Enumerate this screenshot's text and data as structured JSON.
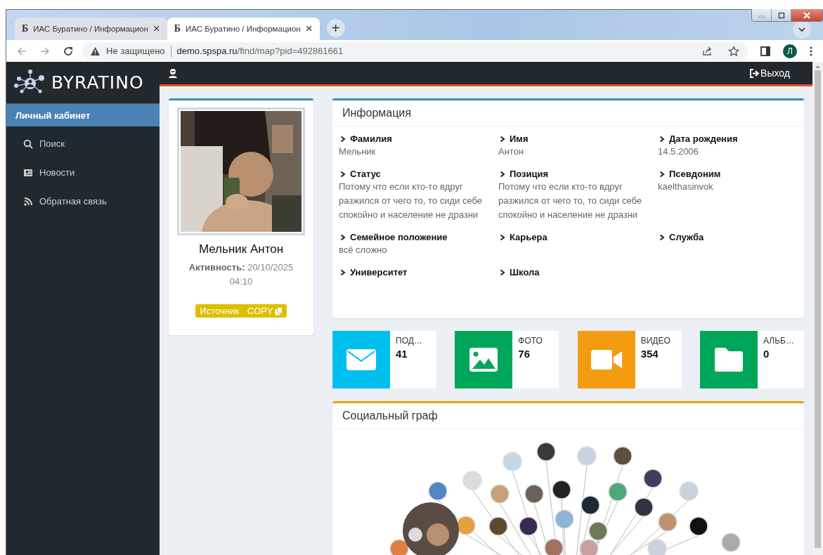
{
  "browser": {
    "tabs": [
      {
        "favicon": "Б",
        "title": "ИАС Буратино / Информацион",
        "selected": false
      },
      {
        "favicon": "Б",
        "title": "ИАС Буратино / Информацион",
        "selected": true
      }
    ],
    "new_tab": "+",
    "close": "×",
    "security": "Не защищено",
    "url_host": "demo.spspa.ru",
    "url_path": "/find/map?pid=492861661",
    "profile_initial": "Л"
  },
  "app": {
    "logo": "BYRATINO",
    "logout": "Выход",
    "sidebar": {
      "items": [
        {
          "label": "Личный кабинет",
          "selected": true,
          "kind": "plain"
        },
        {
          "label": "Поиск",
          "selected": false,
          "kind": "search"
        },
        {
          "label": "Новости",
          "selected": false,
          "kind": "news"
        },
        {
          "label": "Обратная связь",
          "selected": false,
          "kind": "feed"
        }
      ]
    },
    "profile": {
      "name": "Мельник Антон",
      "activity_label": "Активность:",
      "activity_value": "20/10/2025 04:10",
      "source": "Источник",
      "copy": "COPY"
    },
    "info": {
      "title": "Информация",
      "fields": [
        {
          "label": "Фамилия",
          "value": "Мельник"
        },
        {
          "label": "Имя",
          "value": "Антон"
        },
        {
          "label": "Дата рождения",
          "value": "14.5.2006"
        },
        {
          "label": "Статус",
          "value": "Потому что если кто-то вдруг разжился от чего то, то сиди себе спокойно и население не дразни"
        },
        {
          "label": "Позиция",
          "value": "Потому что если кто-то вдруг разжился от чего то, то сиди себе спокойно и население не дразни"
        },
        {
          "label": "Псевдоним",
          "value": "kaelthasinvok"
        },
        {
          "label": "Семейное положение",
          "value": "всё сложно"
        },
        {
          "label": "Карьера"
        },
        {
          "label": "Служба"
        },
        {
          "label": "Университет"
        },
        {
          "label": "Школа"
        }
      ]
    },
    "stats": [
      {
        "label": "ПОД…",
        "count": "41",
        "color": "#00bfef",
        "kind": "messages"
      },
      {
        "label": "ФОТО",
        "count": "76",
        "color": "#00a65a",
        "kind": "photos"
      },
      {
        "label": "ВИДЕО",
        "count": "354",
        "color": "#f39c12",
        "kind": "videos"
      },
      {
        "label": "АЛЬБ…",
        "count": "0",
        "color": "#00a65a",
        "kind": "albums"
      }
    ],
    "graph": {
      "title": "Социальный граф"
    }
  }
}
